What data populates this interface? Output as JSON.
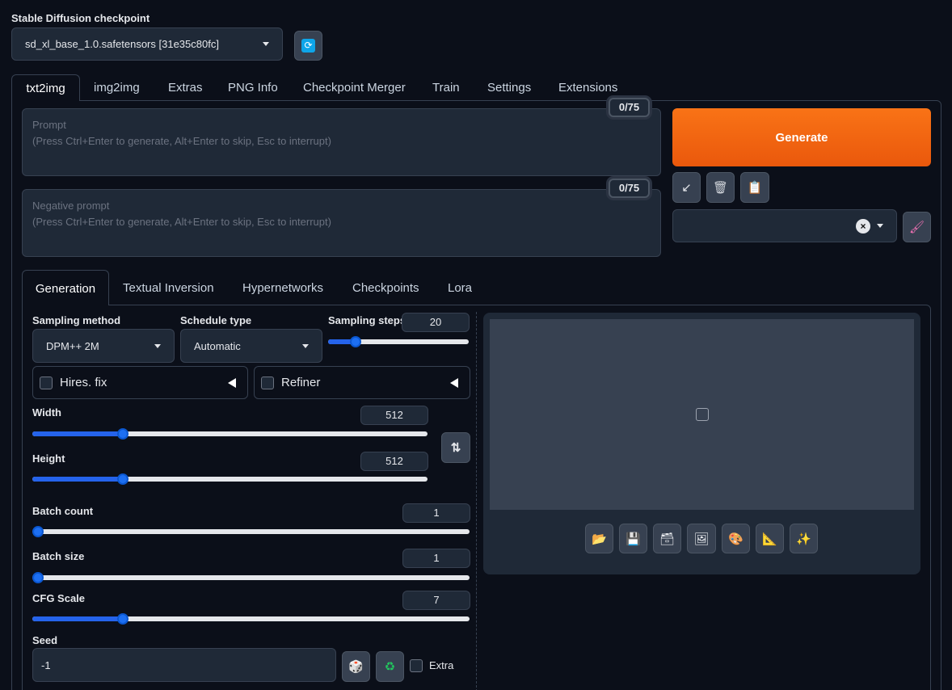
{
  "checkpoint": {
    "label": "Stable Diffusion checkpoint",
    "value": "sd_xl_base_1.0.safetensors [31e35c80fc]"
  },
  "main_tabs": [
    "txt2img",
    "img2img",
    "Extras",
    "PNG Info",
    "Checkpoint Merger",
    "Train",
    "Settings",
    "Extensions"
  ],
  "prompt": {
    "label": "Prompt",
    "hint": "(Press Ctrl+Enter to generate, Alt+Enter to skip, Esc to interrupt)",
    "counter": "0/75"
  },
  "negative_prompt": {
    "label": "Negative prompt",
    "hint": "(Press Ctrl+Enter to generate, Alt+Enter to skip, Esc to interrupt)",
    "counter": "0/75"
  },
  "generate": {
    "label": "Generate"
  },
  "sub_tabs": [
    "Generation",
    "Textual Inversion",
    "Hypernetworks",
    "Checkpoints",
    "Lora"
  ],
  "sampling": {
    "method_label": "Sampling method",
    "method": "DPM++ 2M",
    "schedule_label": "Schedule type",
    "schedule": "Automatic",
    "steps_label": "Sampling steps",
    "steps": "20"
  },
  "accordions": {
    "hires": "Hires. fix",
    "refiner": "Refiner"
  },
  "width": {
    "label": "Width",
    "value": "512"
  },
  "height": {
    "label": "Height",
    "value": "512"
  },
  "batch_count": {
    "label": "Batch count",
    "value": "1"
  },
  "batch_size": {
    "label": "Batch size",
    "value": "1"
  },
  "cfg": {
    "label": "CFG Scale",
    "value": "7"
  },
  "seed": {
    "label": "Seed",
    "value": "-1",
    "extra": "Extra"
  },
  "sliders": {
    "steps": 0.17,
    "width": 0.22,
    "height": 0.22,
    "batch_count": 0.0,
    "batch_size": 0.0,
    "cfg": 0.2
  },
  "colors": {
    "generate": "#f97316",
    "accent": "#2563eb",
    "bg": "#0b0f19"
  }
}
